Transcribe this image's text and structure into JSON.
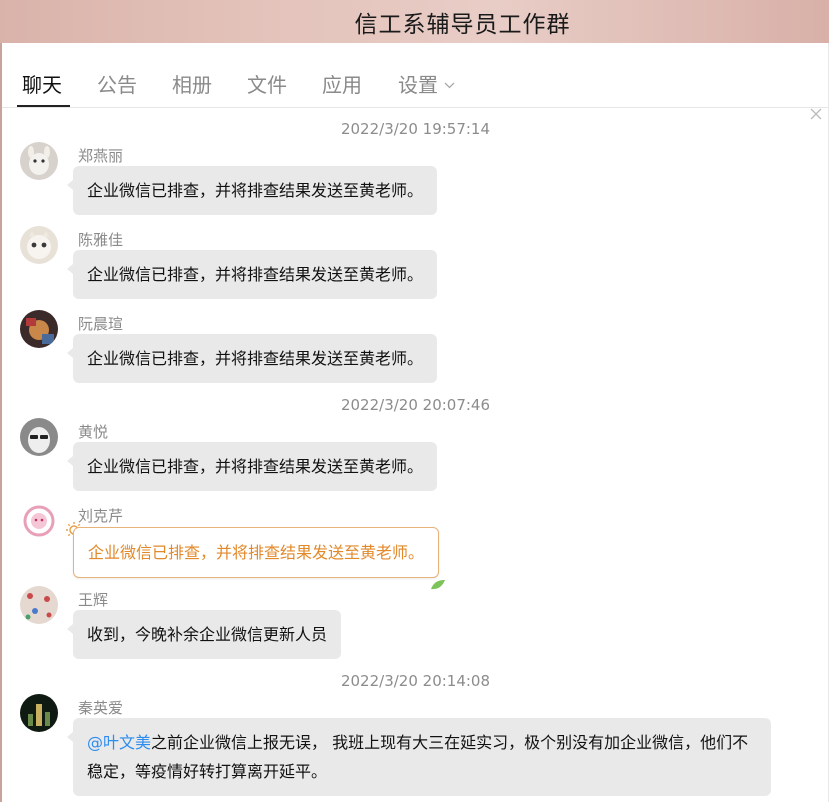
{
  "window": {
    "title": "信工系辅导员工作群"
  },
  "tabs": [
    {
      "label": "聊天",
      "active": true
    },
    {
      "label": "公告",
      "active": false
    },
    {
      "label": "相册",
      "active": false
    },
    {
      "label": "文件",
      "active": false
    },
    {
      "label": "应用",
      "active": false
    },
    {
      "label": "设置",
      "active": false,
      "icon": "chevron-down-icon"
    }
  ],
  "chat": {
    "timestamps": [
      "2022/3/20 19:57:14",
      "2022/3/20 20:07:46",
      "2022/3/20 20:14:08"
    ],
    "messages": [
      {
        "sender": "郑燕丽",
        "text": "企业微信已排查，并将排查结果发送至黄老师。"
      },
      {
        "sender": "陈雅佳",
        "text": "企业微信已排查，并将排查结果发送至黄老师。"
      },
      {
        "sender": "阮晨瑄",
        "text": "企业微信已排查，并将排查结果发送至黄老师。"
      },
      {
        "sender": "黄悦",
        "text": "企业微信已排查，并将排查结果发送至黄老师。"
      },
      {
        "sender": "刘克芹",
        "text": "企业微信已排查，并将排查结果发送至黄老师。",
        "style_color": "#e2892a"
      },
      {
        "sender": "王辉",
        "text": "收到，今晚补余企业微信更新人员"
      },
      {
        "sender": "秦英爱",
        "mention": "@叶文美",
        "text": "之前企业微信上报无误， 我班上现有大三在延实习，极个别没有加企业微信，他们不稳定，等疫情好转打算离开延平。"
      }
    ]
  },
  "colors": {
    "mention": "#2d8cf0",
    "special_bubble_text": "#e2892a",
    "bubble_bg": "#e9e9e9"
  }
}
